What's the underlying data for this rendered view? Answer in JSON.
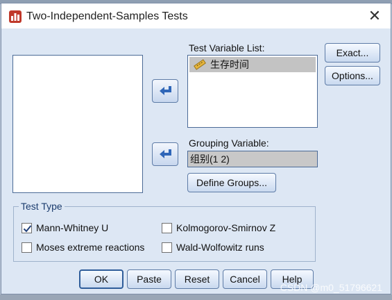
{
  "window": {
    "title": "Two-Independent-Samples Tests",
    "close_symbol": "✕"
  },
  "labels": {
    "test_variable_list": "Test Variable List:",
    "grouping_variable": "Grouping Variable:"
  },
  "test_variables": [
    {
      "name": "生存时间",
      "selected": true,
      "icon": "scale-ruler-icon"
    }
  ],
  "grouping_variable_value": "组别(1 2)",
  "buttons": {
    "exact": "Exact...",
    "options": "Options...",
    "define_groups": "Define Groups...",
    "ok": "OK",
    "paste": "Paste",
    "reset": "Reset",
    "cancel": "Cancel",
    "help": "Help"
  },
  "test_type": {
    "legend": "Test Type",
    "options": [
      {
        "label": "Mann-Whitney U",
        "checked": true
      },
      {
        "label": "Kolmogorov-Smirnov Z",
        "checked": false
      },
      {
        "label": "Moses extreme reactions",
        "checked": false
      },
      {
        "label": "Wald-Wolfowitz runs",
        "checked": false
      }
    ]
  },
  "watermark": "CSDN @m0_51796621",
  "colors": {
    "dialog_bg": "#dde7f4",
    "selected_item_bg": "#c3c3c3",
    "arrow_blue": "#2f66b8",
    "check_color": "#1f3f7a"
  }
}
